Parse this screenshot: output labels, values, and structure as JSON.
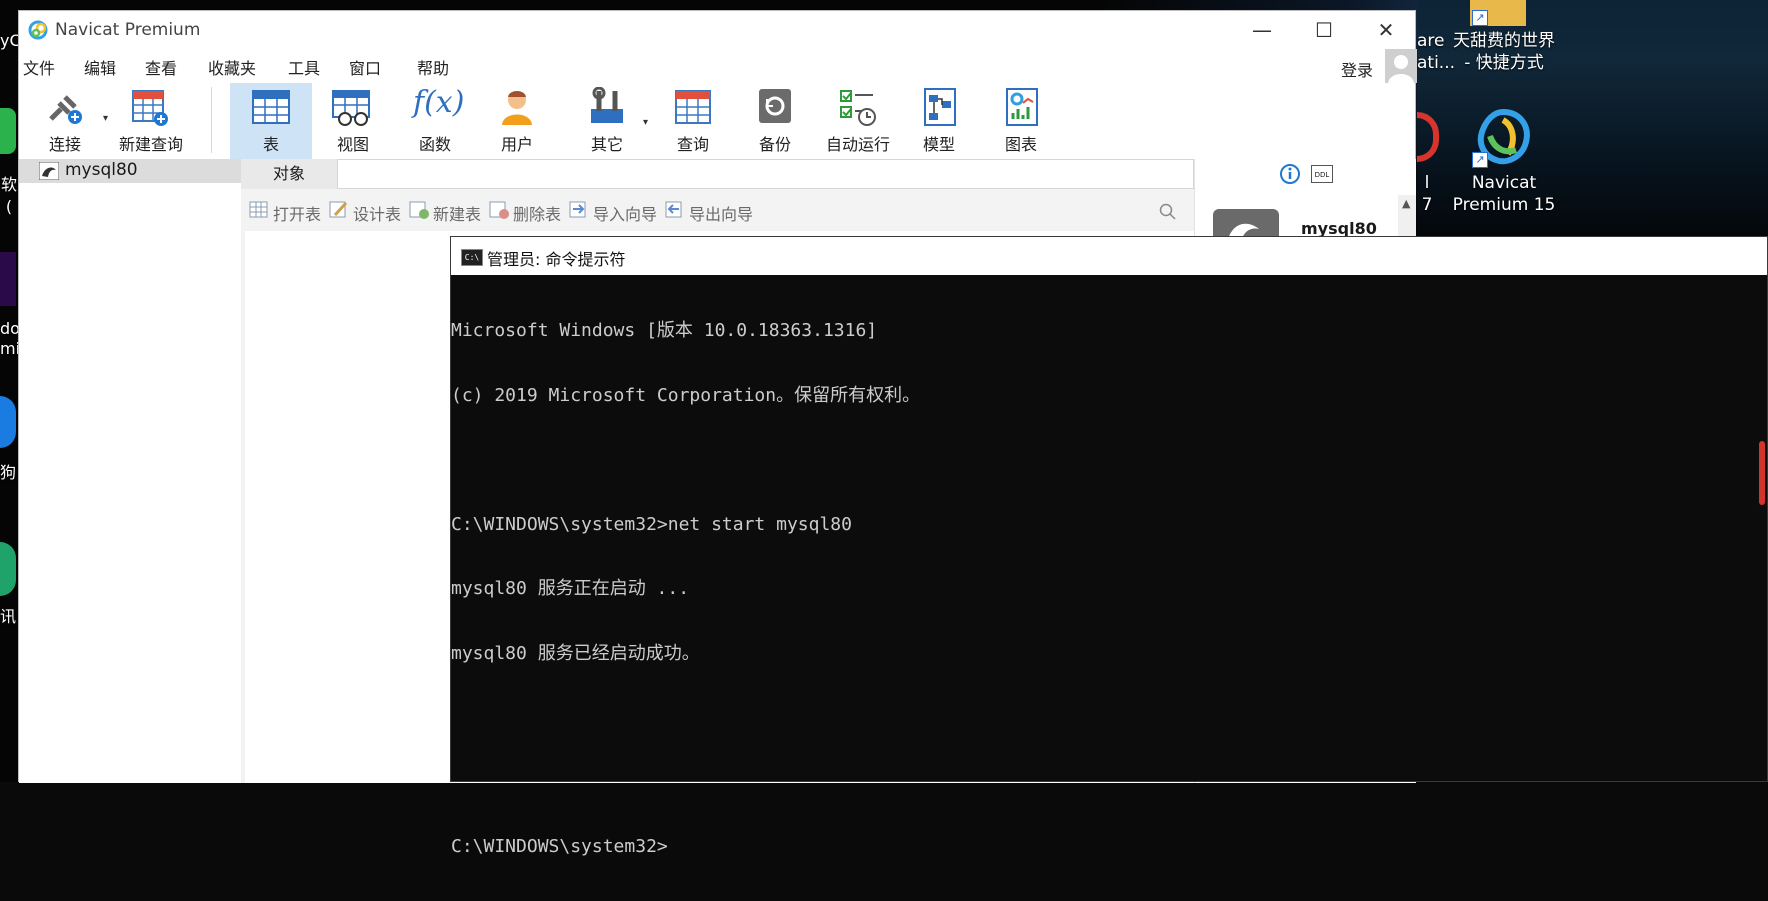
{
  "desktop": {
    "right_icons": [
      {
        "name": "fragment-top-left",
        "label": "are\nati..."
      },
      {
        "name": "shortcut-folder",
        "label": "天甜费的世界\n- 快捷方式"
      },
      {
        "name": "fragment-mid",
        "label": "l 7"
      },
      {
        "name": "navicat-shortcut",
        "label": "Navicat\nPremium 15"
      }
    ],
    "left_fragments": [
      "yC",
      "软(",
      "do",
      "mie",
      "狗",
      "讯"
    ]
  },
  "navicat": {
    "title": "Navicat Premium",
    "controls": [
      "—",
      "☐",
      "✕"
    ],
    "menu": [
      "文件",
      "编辑",
      "查看",
      "收藏夹",
      "工具",
      "窗口",
      "帮助"
    ],
    "login": "登录",
    "toolbar": [
      {
        "label": "连接",
        "icon": "connect-icon"
      },
      {
        "label": "新建查询",
        "icon": "new-query-icon"
      },
      {
        "label": "表",
        "icon": "table-icon",
        "active": true
      },
      {
        "label": "视图",
        "icon": "view-icon"
      },
      {
        "label": "函数",
        "icon": "function-icon"
      },
      {
        "label": "用户",
        "icon": "user-icon"
      },
      {
        "label": "其它",
        "icon": "tools-icon"
      },
      {
        "label": "查询",
        "icon": "query-icon"
      },
      {
        "label": "备份",
        "icon": "backup-icon"
      },
      {
        "label": "自动运行",
        "icon": "schedule-icon"
      },
      {
        "label": "模型",
        "icon": "model-icon"
      },
      {
        "label": "图表",
        "icon": "chart-icon"
      }
    ],
    "connection": "mysql80",
    "object_tab": "对象",
    "object_actions": [
      "打开表",
      "设计表",
      "新建表",
      "删除表",
      "导入向导",
      "导出向导"
    ],
    "info_panel": {
      "name": "mysql80",
      "ddl": "DDL"
    }
  },
  "cmd": {
    "title": "管理员: 命令提示符",
    "lines": [
      "Microsoft Windows [版本 10.0.18363.1316]",
      "(c) 2019 Microsoft Corporation。保留所有权利。",
      "",
      "C:\\WINDOWS\\system32>net start mysql80",
      "mysql80 服务正在启动 ...",
      "mysql80 服务已经启动成功。",
      "",
      "",
      "C:\\WINDOWS\\system32>"
    ]
  }
}
